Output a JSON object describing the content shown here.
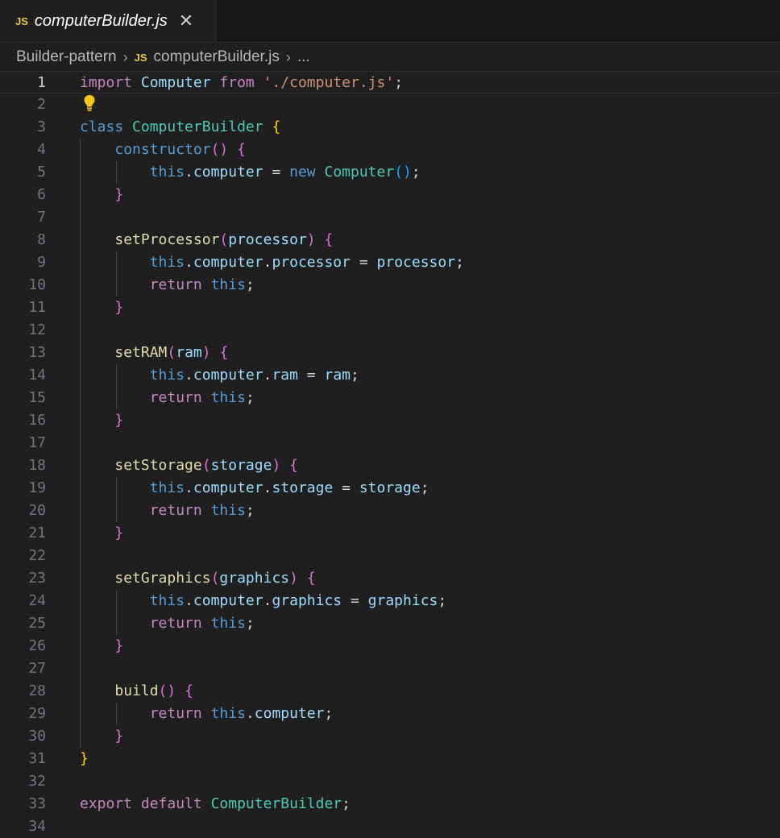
{
  "tab": {
    "icon": "JS",
    "filename": "computerBuilder.js",
    "close_icon": "close-icon"
  },
  "breadcrumb": {
    "folder": "Builder-pattern",
    "file_icon": "JS",
    "file": "computerBuilder.js",
    "ellipsis": "..."
  },
  "editor": {
    "active_line": 1,
    "lines": [
      {
        "n": "1",
        "tokens": [
          [
            "import",
            "kw"
          ],
          [
            " ",
            "pl"
          ],
          [
            "Computer",
            "var"
          ],
          [
            " ",
            "pl"
          ],
          [
            "from",
            "kw"
          ],
          [
            " ",
            "pl"
          ],
          [
            "'./computer.js'",
            "str"
          ],
          [
            ";",
            "pl"
          ]
        ]
      },
      {
        "n": "2",
        "tokens": []
      },
      {
        "n": "3",
        "tokens": [
          [
            "class",
            "kw2"
          ],
          [
            " ",
            "pl"
          ],
          [
            "ComputerBuilder",
            "cls"
          ],
          [
            " ",
            "pl"
          ],
          [
            "{",
            "p1"
          ]
        ]
      },
      {
        "n": "4",
        "tokens": [
          [
            "    ",
            "pl"
          ],
          [
            "constructor",
            "kw2"
          ],
          [
            "()",
            "p2"
          ],
          [
            " ",
            "pl"
          ],
          [
            "{",
            "p2"
          ]
        ]
      },
      {
        "n": "5",
        "tokens": [
          [
            "        ",
            "pl"
          ],
          [
            "this",
            "kw2"
          ],
          [
            ".",
            "pl"
          ],
          [
            "computer",
            "var"
          ],
          [
            " = ",
            "pl"
          ],
          [
            "new",
            "kw2"
          ],
          [
            " ",
            "pl"
          ],
          [
            "Computer",
            "cls"
          ],
          [
            "()",
            "p3"
          ],
          [
            ";",
            "pl"
          ]
        ]
      },
      {
        "n": "6",
        "tokens": [
          [
            "    ",
            "pl"
          ],
          [
            "}",
            "p2"
          ]
        ]
      },
      {
        "n": "7",
        "tokens": []
      },
      {
        "n": "8",
        "tokens": [
          [
            "    ",
            "pl"
          ],
          [
            "setProcessor",
            "fn"
          ],
          [
            "(",
            "p2"
          ],
          [
            "processor",
            "var"
          ],
          [
            ")",
            "p2"
          ],
          [
            " ",
            "pl"
          ],
          [
            "{",
            "p2"
          ]
        ]
      },
      {
        "n": "9",
        "tokens": [
          [
            "        ",
            "pl"
          ],
          [
            "this",
            "kw2"
          ],
          [
            ".",
            "pl"
          ],
          [
            "computer",
            "var"
          ],
          [
            ".",
            "pl"
          ],
          [
            "processor",
            "var"
          ],
          [
            " = ",
            "pl"
          ],
          [
            "processor",
            "var"
          ],
          [
            ";",
            "pl"
          ]
        ]
      },
      {
        "n": "10",
        "tokens": [
          [
            "        ",
            "pl"
          ],
          [
            "return",
            "kw"
          ],
          [
            " ",
            "pl"
          ],
          [
            "this",
            "kw2"
          ],
          [
            ";",
            "pl"
          ]
        ]
      },
      {
        "n": "11",
        "tokens": [
          [
            "    ",
            "pl"
          ],
          [
            "}",
            "p2"
          ]
        ]
      },
      {
        "n": "12",
        "tokens": []
      },
      {
        "n": "13",
        "tokens": [
          [
            "    ",
            "pl"
          ],
          [
            "setRAM",
            "fn"
          ],
          [
            "(",
            "p2"
          ],
          [
            "ram",
            "var"
          ],
          [
            ")",
            "p2"
          ],
          [
            " ",
            "pl"
          ],
          [
            "{",
            "p2"
          ]
        ]
      },
      {
        "n": "14",
        "tokens": [
          [
            "        ",
            "pl"
          ],
          [
            "this",
            "kw2"
          ],
          [
            ".",
            "pl"
          ],
          [
            "computer",
            "var"
          ],
          [
            ".",
            "pl"
          ],
          [
            "ram",
            "var"
          ],
          [
            " = ",
            "pl"
          ],
          [
            "ram",
            "var"
          ],
          [
            ";",
            "pl"
          ]
        ]
      },
      {
        "n": "15",
        "tokens": [
          [
            "        ",
            "pl"
          ],
          [
            "return",
            "kw"
          ],
          [
            " ",
            "pl"
          ],
          [
            "this",
            "kw2"
          ],
          [
            ";",
            "pl"
          ]
        ]
      },
      {
        "n": "16",
        "tokens": [
          [
            "    ",
            "pl"
          ],
          [
            "}",
            "p2"
          ]
        ]
      },
      {
        "n": "17",
        "tokens": []
      },
      {
        "n": "18",
        "tokens": [
          [
            "    ",
            "pl"
          ],
          [
            "setStorage",
            "fn"
          ],
          [
            "(",
            "p2"
          ],
          [
            "storage",
            "var"
          ],
          [
            ")",
            "p2"
          ],
          [
            " ",
            "pl"
          ],
          [
            "{",
            "p2"
          ]
        ]
      },
      {
        "n": "19",
        "tokens": [
          [
            "        ",
            "pl"
          ],
          [
            "this",
            "kw2"
          ],
          [
            ".",
            "pl"
          ],
          [
            "computer",
            "var"
          ],
          [
            ".",
            "pl"
          ],
          [
            "storage",
            "var"
          ],
          [
            " = ",
            "pl"
          ],
          [
            "storage",
            "var"
          ],
          [
            ";",
            "pl"
          ]
        ]
      },
      {
        "n": "20",
        "tokens": [
          [
            "        ",
            "pl"
          ],
          [
            "return",
            "kw"
          ],
          [
            " ",
            "pl"
          ],
          [
            "this",
            "kw2"
          ],
          [
            ";",
            "pl"
          ]
        ]
      },
      {
        "n": "21",
        "tokens": [
          [
            "    ",
            "pl"
          ],
          [
            "}",
            "p2"
          ]
        ]
      },
      {
        "n": "22",
        "tokens": []
      },
      {
        "n": "23",
        "tokens": [
          [
            "    ",
            "pl"
          ],
          [
            "setGraphics",
            "fn"
          ],
          [
            "(",
            "p2"
          ],
          [
            "graphics",
            "var"
          ],
          [
            ")",
            "p2"
          ],
          [
            " ",
            "pl"
          ],
          [
            "{",
            "p2"
          ]
        ]
      },
      {
        "n": "24",
        "tokens": [
          [
            "        ",
            "pl"
          ],
          [
            "this",
            "kw2"
          ],
          [
            ".",
            "pl"
          ],
          [
            "computer",
            "var"
          ],
          [
            ".",
            "pl"
          ],
          [
            "graphics",
            "var"
          ],
          [
            " = ",
            "pl"
          ],
          [
            "graphics",
            "var"
          ],
          [
            ";",
            "pl"
          ]
        ]
      },
      {
        "n": "25",
        "tokens": [
          [
            "        ",
            "pl"
          ],
          [
            "return",
            "kw"
          ],
          [
            " ",
            "pl"
          ],
          [
            "this",
            "kw2"
          ],
          [
            ";",
            "pl"
          ]
        ]
      },
      {
        "n": "26",
        "tokens": [
          [
            "    ",
            "pl"
          ],
          [
            "}",
            "p2"
          ]
        ]
      },
      {
        "n": "27",
        "tokens": []
      },
      {
        "n": "28",
        "tokens": [
          [
            "    ",
            "pl"
          ],
          [
            "build",
            "fn"
          ],
          [
            "()",
            "p2"
          ],
          [
            " ",
            "pl"
          ],
          [
            "{",
            "p2"
          ]
        ]
      },
      {
        "n": "29",
        "tokens": [
          [
            "        ",
            "pl"
          ],
          [
            "return",
            "kw"
          ],
          [
            " ",
            "pl"
          ],
          [
            "this",
            "kw2"
          ],
          [
            ".",
            "pl"
          ],
          [
            "computer",
            "var"
          ],
          [
            ";",
            "pl"
          ]
        ]
      },
      {
        "n": "30",
        "tokens": [
          [
            "    ",
            "pl"
          ],
          [
            "}",
            "p2"
          ]
        ]
      },
      {
        "n": "31",
        "tokens": [
          [
            "}",
            "p1"
          ]
        ]
      },
      {
        "n": "32",
        "tokens": []
      },
      {
        "n": "33",
        "tokens": [
          [
            "export",
            "kw"
          ],
          [
            " ",
            "pl"
          ],
          [
            "default",
            "kw"
          ],
          [
            " ",
            "pl"
          ],
          [
            "ComputerBuilder",
            "cls"
          ],
          [
            ";",
            "pl"
          ]
        ]
      },
      {
        "n": "34",
        "tokens": []
      }
    ]
  },
  "colors": {
    "background": "#1f1f1f",
    "keyword": "#c586c0",
    "storage": "#569cd6",
    "class": "#4ec9b0",
    "variable": "#9cdcfe",
    "function": "#dcdcaa",
    "string": "#ce9178",
    "bracket_gold": "#ffd700",
    "bracket_orchid": "#da70d6",
    "bracket_blue": "#179fff",
    "lightbulb": "#f5c518"
  }
}
